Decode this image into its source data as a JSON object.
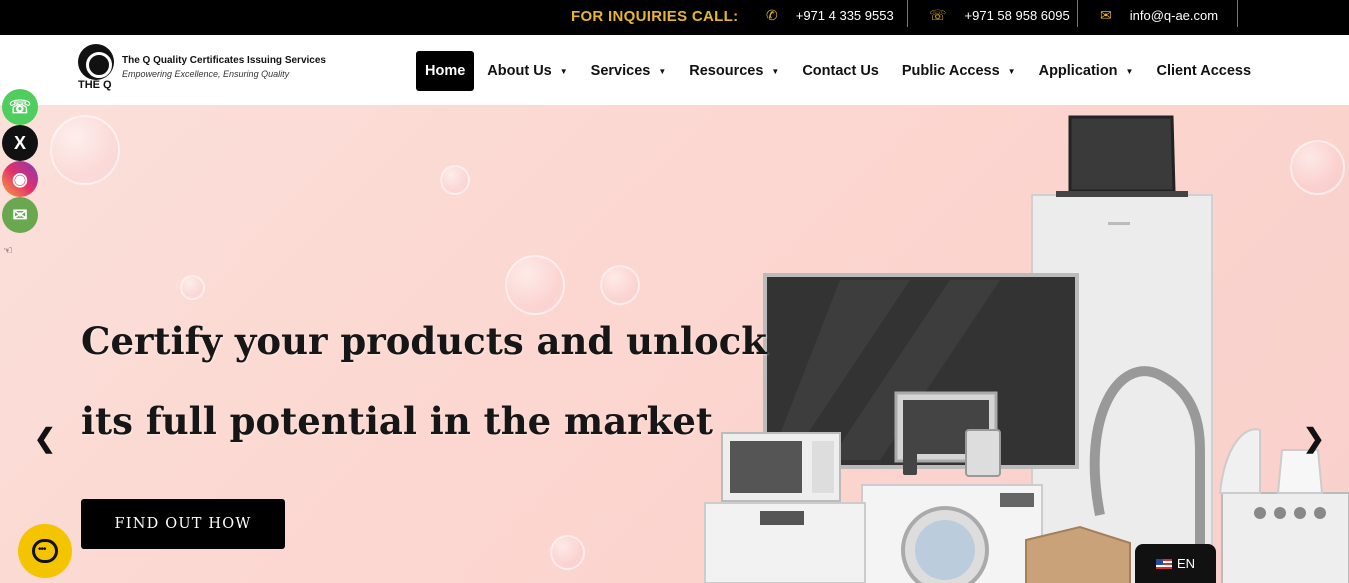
{
  "topbar": {
    "inquiries_label": "FOR INQUIRIES CALL:",
    "phone": "+971 4 335 9553",
    "whatsapp": "+971 58 958 6095",
    "email": "info@q-ae.com",
    "icons": [
      "phone-icon",
      "whatsapp-icon",
      "email-icon"
    ],
    "accent_color": "#e8b62c"
  },
  "logo": {
    "word": "THE Q",
    "title": "The Q Quality Certificates Issuing Services",
    "tagline": "Empowering Excellence, Ensuring Quality"
  },
  "nav": {
    "items": [
      {
        "label": "Home",
        "active": true,
        "dropdown": false
      },
      {
        "label": "About Us",
        "dropdown": true
      },
      {
        "label": "Services",
        "dropdown": true
      },
      {
        "label": "Resources",
        "dropdown": true
      },
      {
        "label": "Contact Us",
        "dropdown": false
      },
      {
        "label": "Public Access",
        "dropdown": true
      },
      {
        "label": "Application",
        "dropdown": true
      },
      {
        "label": "Client Access",
        "dropdown": false
      }
    ]
  },
  "hero": {
    "headline_line1": "Certify your products and unlock",
    "headline_line2": "its full potential in the market",
    "cta_label": "FIND OUT HOW",
    "background_color": "#fcd6d0"
  },
  "social": {
    "items": [
      "whatsapp-icon",
      "x-icon",
      "instagram-icon",
      "email-icon"
    ]
  },
  "language": {
    "label": "EN"
  }
}
